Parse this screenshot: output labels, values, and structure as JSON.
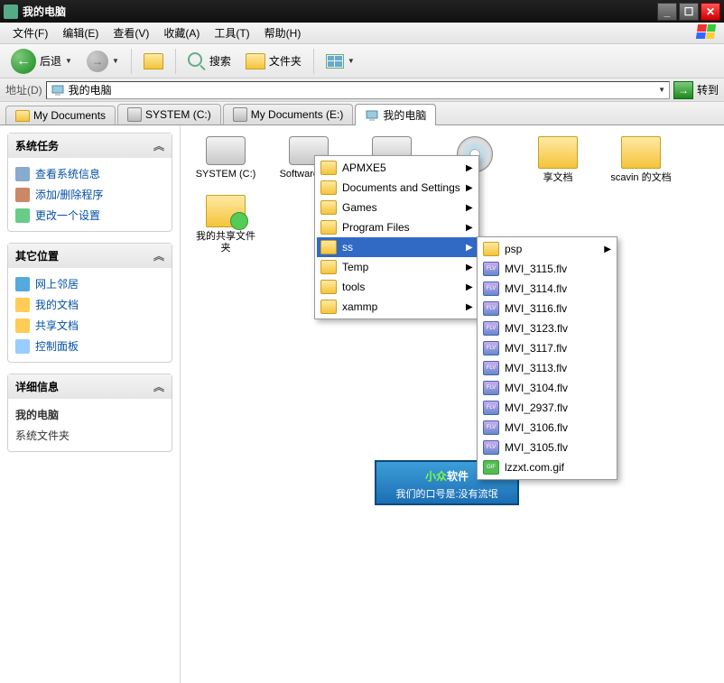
{
  "titlebar": {
    "title": "我的电脑"
  },
  "menu": {
    "file": "文件(F)",
    "edit": "编辑(E)",
    "view": "查看(V)",
    "favorites": "收藏(A)",
    "tools": "工具(T)",
    "help": "帮助(H)"
  },
  "toolbar": {
    "back": "后退",
    "search": "搜索",
    "folders": "文件夹"
  },
  "address": {
    "label": "地址(D)",
    "value": "我的电脑",
    "go": "转到"
  },
  "tabs": [
    {
      "label": "My Documents",
      "type": "folder"
    },
    {
      "label": "SYSTEM (C:)",
      "type": "drive"
    },
    {
      "label": "My Documents (E:)",
      "type": "drive"
    },
    {
      "label": "我的电脑",
      "type": "computer",
      "active": true
    }
  ],
  "sidebar": {
    "systemTasks": {
      "title": "系统任务",
      "items": [
        "查看系统信息",
        "添加/删除程序",
        "更改一个设置"
      ]
    },
    "otherPlaces": {
      "title": "其它位置",
      "items": [
        "网上邻居",
        "我的文档",
        "共享文档",
        "控制面板"
      ]
    },
    "details": {
      "title": "详细信息",
      "name": "我的电脑",
      "desc": "系统文件夹"
    }
  },
  "files": [
    {
      "label": "SYSTEM (C:)",
      "kind": "drive"
    },
    {
      "label": "Software (D:)",
      "kind": "drive",
      "dropdown": true
    },
    {
      "label": "",
      "kind": "drive"
    },
    {
      "label": "",
      "kind": "cd"
    },
    {
      "label": "享文档",
      "kind": "folder"
    },
    {
      "label": "scavin 的文档",
      "kind": "folder"
    },
    {
      "label": "我的共享文件夹",
      "kind": "folder-share"
    }
  ],
  "menu1": [
    {
      "label": "APMXE5",
      "arrow": true
    },
    {
      "label": "Documents and Settings",
      "arrow": true
    },
    {
      "label": "Games",
      "arrow": true
    },
    {
      "label": "Program Files",
      "arrow": true
    },
    {
      "label": "ss",
      "arrow": true,
      "hl": true
    },
    {
      "label": "Temp",
      "arrow": true
    },
    {
      "label": "tools",
      "arrow": true
    },
    {
      "label": "xammp",
      "arrow": true
    }
  ],
  "menu2": [
    {
      "label": "psp",
      "kind": "folder",
      "arrow": true
    },
    {
      "label": "MVI_3115.flv",
      "kind": "flv"
    },
    {
      "label": "MVI_3114.flv",
      "kind": "flv"
    },
    {
      "label": "MVI_3116.flv",
      "kind": "flv"
    },
    {
      "label": "MVI_3123.flv",
      "kind": "flv"
    },
    {
      "label": "MVI_3117.flv",
      "kind": "flv"
    },
    {
      "label": "MVI_3113.flv",
      "kind": "flv"
    },
    {
      "label": "MVI_3104.flv",
      "kind": "flv"
    },
    {
      "label": "MVI_2937.flv",
      "kind": "flv"
    },
    {
      "label": "MVI_3106.flv",
      "kind": "flv"
    },
    {
      "label": "MVI_3105.flv",
      "kind": "flv"
    },
    {
      "label": "lzzxt.com.gif",
      "kind": "gif"
    }
  ],
  "promo": {
    "line1a": "小众",
    "line1b": "软件",
    "line2": "我们的口号是:没有流氓"
  }
}
